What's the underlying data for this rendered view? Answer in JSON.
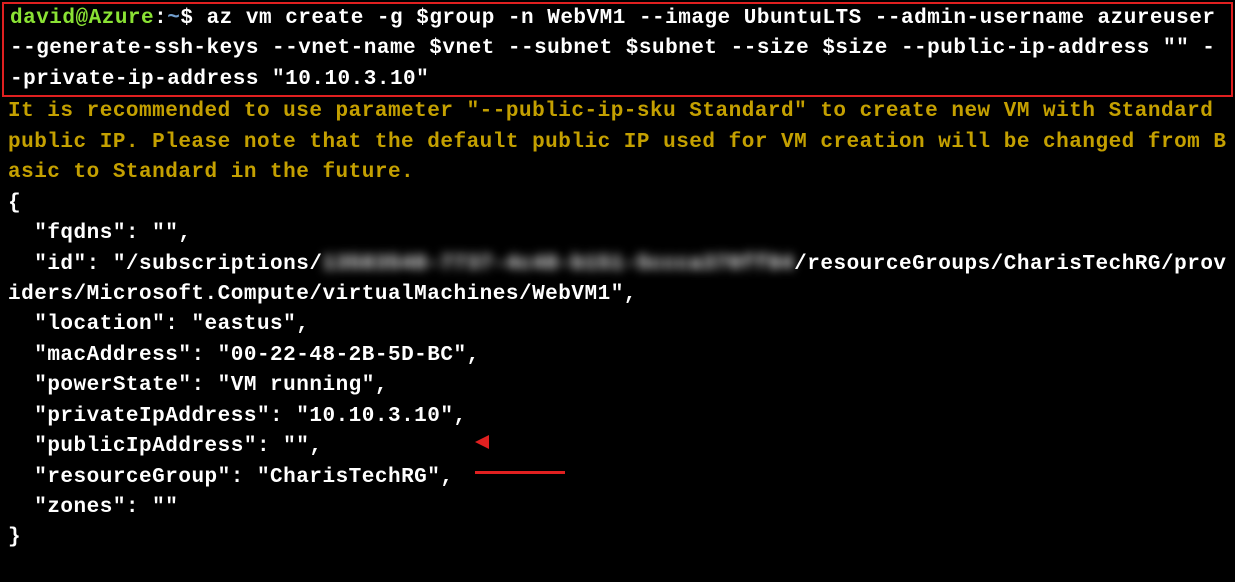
{
  "prompt": {
    "user": "david",
    "at": "@",
    "host": "Azure",
    "colon": ":",
    "path": "~",
    "dollar": "$"
  },
  "command": "az vm create -g $group -n WebVM1 --image UbuntuLTS --admin-username azureuser --generate-ssh-keys --vnet-name $vnet --subnet $subnet --size $size --public-ip-address \"\" --private-ip-address \"10.10.3.10\"",
  "warning": "It is recommended to use parameter \"--public-ip-sku Standard\" to create new VM with Standard public IP. Please note that the default public IP used for VM creation will be changed from Basic to Standard in the future.",
  "json_output": {
    "open_brace": "{",
    "fqdns_line": "  \"fqdns\": \"\",",
    "id_prefix": "  \"id\": \"/subscriptions/",
    "id_blurred": "13583548-7737-4c48-b151-5ccca370ff84",
    "id_suffix": "/resourceGroups/CharisTechRG/providers/Microsoft.Compute/virtualMachines/WebVM1\",",
    "location_line": "  \"location\": \"eastus\",",
    "mac_line": "  \"macAddress\": \"00-22-48-2B-5D-BC\",",
    "power_line": "  \"powerState\": \"VM running\",",
    "private_ip_line": "  \"privateIpAddress\": \"10.10.3.10\",",
    "public_ip_line": "  \"publicIpAddress\": \"\",",
    "rg_line": "  \"resourceGroup\": \"CharisTechRG\",",
    "zones_line": "  \"zones\": \"\"",
    "close_brace": "}"
  }
}
